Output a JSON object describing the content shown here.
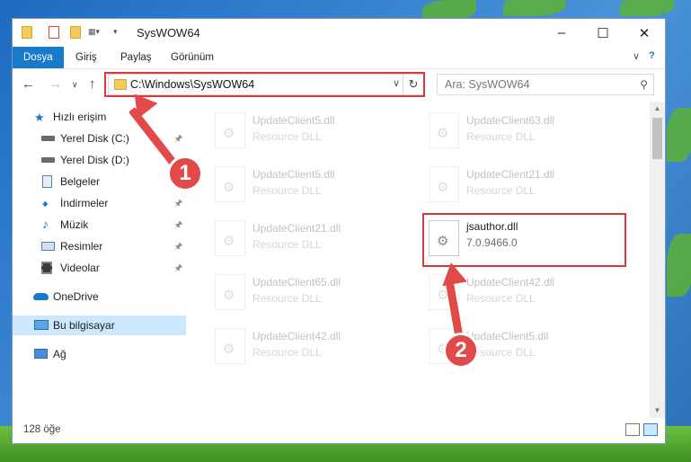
{
  "window": {
    "title": "SysWOW64"
  },
  "ribbon": {
    "tabs": [
      "Dosya",
      "Giriş",
      "Paylaş",
      "Görünüm"
    ]
  },
  "address": {
    "path": "C:\\Windows\\SysWOW64"
  },
  "search": {
    "placeholder": "Ara: SysWOW64"
  },
  "sidebar": {
    "items": [
      {
        "label": "Hızlı erişim",
        "icon": "star-icon"
      },
      {
        "label": "Yerel Disk (C:)",
        "icon": "drive-icon",
        "pinned": true
      },
      {
        "label": "Yerel Disk (D:)",
        "icon": "drive-icon"
      },
      {
        "label": "Belgeler",
        "icon": "document-icon",
        "pinned": true
      },
      {
        "label": "İndirmeler",
        "icon": "download-icon",
        "pinned": true
      },
      {
        "label": "Müzik",
        "icon": "music-icon",
        "pinned": true
      },
      {
        "label": "Resimler",
        "icon": "pictures-icon",
        "pinned": true
      },
      {
        "label": "Videolar",
        "icon": "video-icon",
        "pinned": true
      },
      {
        "label": "OneDrive",
        "icon": "cloud-icon"
      },
      {
        "label": "Bu bilgisayar",
        "icon": "computer-icon",
        "selected": true
      },
      {
        "label": "Ağ",
        "icon": "network-icon"
      }
    ]
  },
  "files": [
    {
      "name": "UpdateClient5.dll",
      "desc": "Resource DLL"
    },
    {
      "name": "UpdateClient63.dll",
      "desc": "Resource DLL"
    },
    {
      "name": "UpdateClient5.dll",
      "desc": "Resource DLL"
    },
    {
      "name": "UpdateClient21.dll",
      "desc": "Resource DLL"
    },
    {
      "name": "UpdateClient21.dll",
      "desc": "Resource DLL"
    },
    {
      "name": "jsauthor.dll",
      "desc": "7.0.9466.0"
    },
    {
      "name": "UpdateClient65.dll",
      "desc": "Resource DLL"
    },
    {
      "name": "UpdateClient42.dll",
      "desc": "Resource DLL"
    },
    {
      "name": "UpdateClient42.dll",
      "desc": "Resource DLL"
    },
    {
      "name": "UpdateClient5.dll",
      "desc": "Resource DLL"
    }
  ],
  "status": {
    "item_count": "128 öğe"
  },
  "annotations": {
    "step1": "1",
    "step2": "2"
  },
  "colors": {
    "accent": "#1979ca",
    "highlight": "#d9393a",
    "selection": "#cce8ff"
  }
}
